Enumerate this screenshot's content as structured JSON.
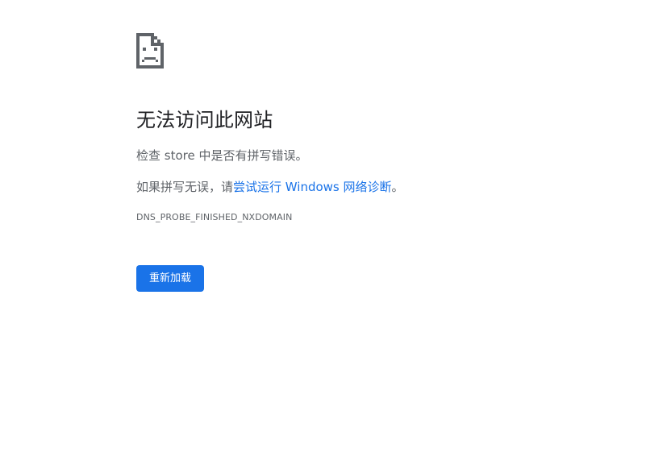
{
  "error_icon": {
    "name": "sad-page-icon",
    "color": "#5f6368"
  },
  "main_title": "无法访问此网站",
  "summary": {
    "prefix": "检查 ",
    "host": "store",
    "suffix": " 中是否有拼写错误。"
  },
  "suggestion": {
    "prefix": "如果拼写无误，请",
    "link_label": "尝试运行 Windows 网络诊断",
    "suffix": "。"
  },
  "error_code": "DNS_PROBE_FINISHED_NXDOMAIN",
  "reload_button": {
    "label": "重新加载",
    "color": "#1a73e8"
  },
  "colors": {
    "title": "#202124",
    "body_text": "#5f6368",
    "link": "#1a73e8",
    "background": "#ffffff"
  }
}
